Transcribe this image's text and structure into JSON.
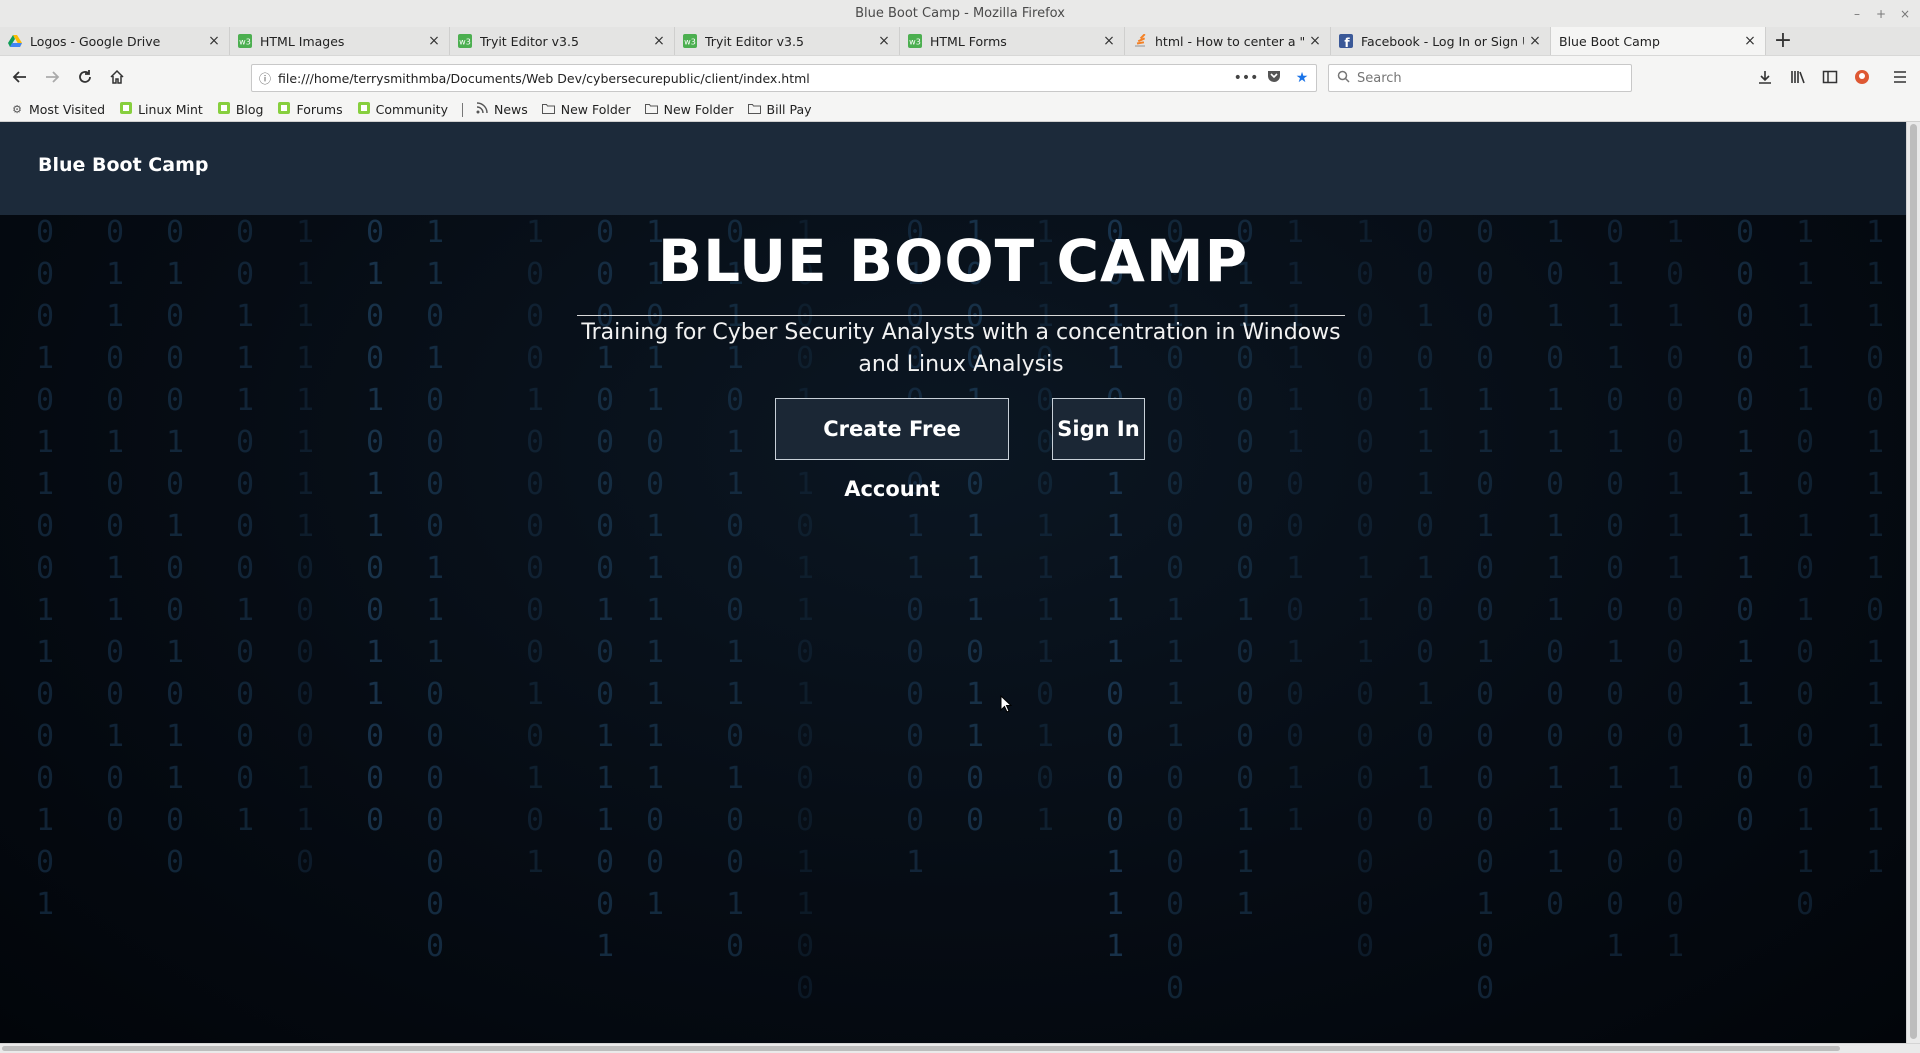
{
  "window": {
    "title": "Blue Boot Camp - Mozilla Firefox",
    "controls": [
      "–",
      "+",
      "×"
    ]
  },
  "tabs": [
    {
      "label": "Logos - Google Drive",
      "favicon": "google-drive-icon",
      "active": false
    },
    {
      "label": "HTML Images",
      "favicon": "w3schools-icon",
      "active": false
    },
    {
      "label": "Tryit Editor v3.5",
      "favicon": "w3schools-icon",
      "active": false
    },
    {
      "label": "Tryit Editor v3.5",
      "favicon": "w3schools-icon",
      "active": false
    },
    {
      "label": "HTML Forms",
      "favicon": "w3schools-icon",
      "active": false
    },
    {
      "label": "html - How to center a \"positi",
      "favicon": "stackoverflow-icon",
      "active": false
    },
    {
      "label": "Facebook - Log In or Sign Up",
      "favicon": "facebook-icon",
      "active": false
    },
    {
      "label": "Blue Boot Camp",
      "favicon": "",
      "active": true
    }
  ],
  "newtab_label": "+",
  "navbar": {
    "url": "file:///home/terrysmithmba/Documents/Web Dev/cybersecurepublic/client/index.html",
    "search_placeholder": "Search"
  },
  "bookmarks": [
    {
      "label": "Most Visited",
      "icon": "gear-icon"
    },
    {
      "label": "Linux Mint",
      "icon": "mint-icon"
    },
    {
      "label": "Blog",
      "icon": "mint-icon"
    },
    {
      "label": "Forums",
      "icon": "mint-icon"
    },
    {
      "label": "Community",
      "icon": "mint-icon"
    },
    {
      "label": "News",
      "icon": "rss-icon"
    },
    {
      "label": "New Folder",
      "icon": "folder-icon"
    },
    {
      "label": "New Folder",
      "icon": "folder-icon"
    },
    {
      "label": "Bill Pay",
      "icon": "folder-icon"
    }
  ],
  "site": {
    "brand": "Blue Boot Camp",
    "hero_title": "BLUE BOOT CAMP",
    "hero_subtitle": "Training for Cyber Security Analysts with a concentration in Windows and Linux Analysis",
    "create_button": "Create Free Account",
    "signin_button": "Sign In"
  },
  "colors": {
    "site_nav": "#1c2a3a",
    "button_bg": "#1b2735",
    "matrix_glyph": "#1c3a55"
  }
}
